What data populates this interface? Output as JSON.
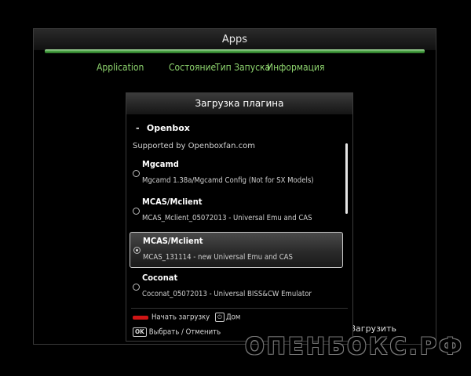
{
  "window": {
    "title": "Apps",
    "accent_color": "#3f9a3a"
  },
  "tabs": [
    {
      "label": "Application",
      "color": "#8fd66f"
    },
    {
      "label": "Состояние",
      "color": "#8fd66f"
    },
    {
      "label": "Тип Запуска",
      "color": "#8fd66f"
    },
    {
      "label": "Информация",
      "color": "#8fd66f"
    }
  ],
  "bottom_action": "Загрузить",
  "watermark": "ОПЕНБОКС.РФ",
  "dialog": {
    "title": "Загрузка плагина",
    "group": {
      "marker": "-",
      "name": "Openbox",
      "supported": "Supported by Openboxfan.com"
    },
    "plugins": [
      {
        "name": "Mgcamd",
        "desc": "Mgcamd 1.38a/Mgcamd Config (Not for SX Models)",
        "selected": false
      },
      {
        "name": "MCAS/Mclient",
        "desc": "MCAS_Mclient_05072013 - Universal Emu and CAS",
        "selected": false
      },
      {
        "name": "MCAS/Mclient",
        "desc": "MCAS_131114 - new Universal Emu and CAS",
        "selected": true
      },
      {
        "name": "Coconat",
        "desc": "Coconat_05072013 - Universal BISS&CW Emulator",
        "selected": false
      }
    ],
    "hints": {
      "red_label": "Начать загрузку",
      "power_icon": "power-icon",
      "power_label": "Дом",
      "ok_key": "OK",
      "ok_label": "Выбрать / Отменить"
    },
    "red_key_color": "#d01515"
  }
}
